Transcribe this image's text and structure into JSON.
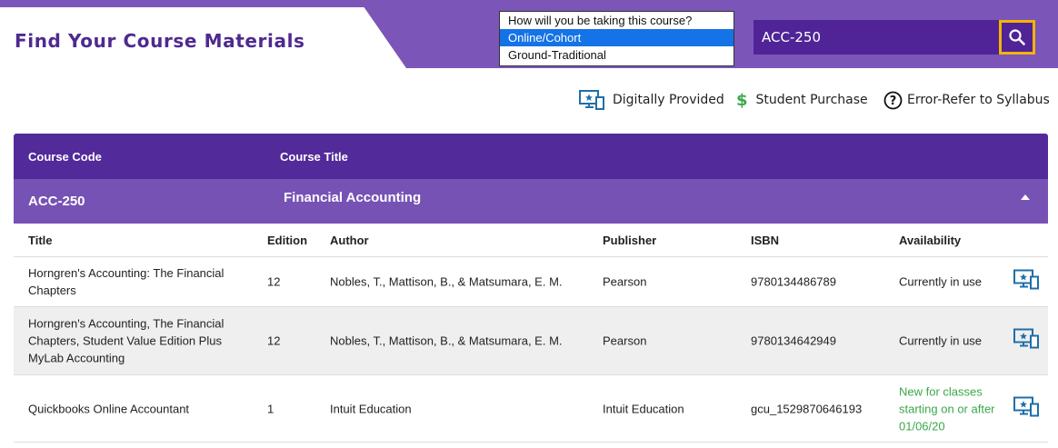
{
  "header": {
    "title": "Find Your Course Materials",
    "course_type_select": {
      "prompt": "How will you be taking this course?",
      "options": [
        "Online/Cohort",
        "Ground-Traditional"
      ],
      "selected": "Online/Cohort"
    },
    "search": {
      "value": "ACC-250",
      "icon": "search-icon"
    }
  },
  "legend": [
    {
      "label": "Digitally Provided",
      "icon": "digital-provided-icon"
    },
    {
      "label": "Student Purchase",
      "icon": "dollar-icon"
    },
    {
      "label": "Error-Refer to Syllabus",
      "icon": "question-circle-icon"
    }
  ],
  "table": {
    "headers": {
      "course_code": "Course Code",
      "course_title": "Course Title"
    },
    "course": {
      "code": "ACC-250",
      "title": "Financial Accounting",
      "expanded": true
    },
    "material_headers": {
      "title": "Title",
      "edition": "Edition",
      "author": "Author",
      "publisher": "Publisher",
      "isbn": "ISBN",
      "availability": "Availability"
    },
    "materials": [
      {
        "title": "Horngren's Accounting: The Financial Chapters",
        "edition": "12",
        "author": "Nobles, T., Mattison, B., & Matsumara, E. M.",
        "publisher": "Pearson",
        "isbn": "9780134486789",
        "availability": "Currently in use",
        "icon": "digital-provided-icon"
      },
      {
        "title": "Horngren's Accounting, The Financial Chapters, Student Value Edition Plus MyLab Accounting",
        "edition": "12",
        "author": "Nobles, T., Mattison, B., & Matsumara, E. M.",
        "publisher": "Pearson",
        "isbn": "9780134642949",
        "availability": "Currently in use",
        "icon": "digital-provided-icon"
      },
      {
        "title": "Quickbooks Online Accountant",
        "edition": "1",
        "author": "Intuit Education",
        "publisher": "Intuit Education",
        "isbn": "gcu_1529870646193",
        "availability": "New for classes starting on or after 01/06/20",
        "icon": "digital-provided-icon"
      }
    ]
  },
  "colors": {
    "brand_purple": "#522a9a",
    "row_purple": "#7652b5",
    "search_focus": "#f4b400",
    "icon_blue": "#1f6fa8",
    "available_green": "#3aa84a"
  }
}
